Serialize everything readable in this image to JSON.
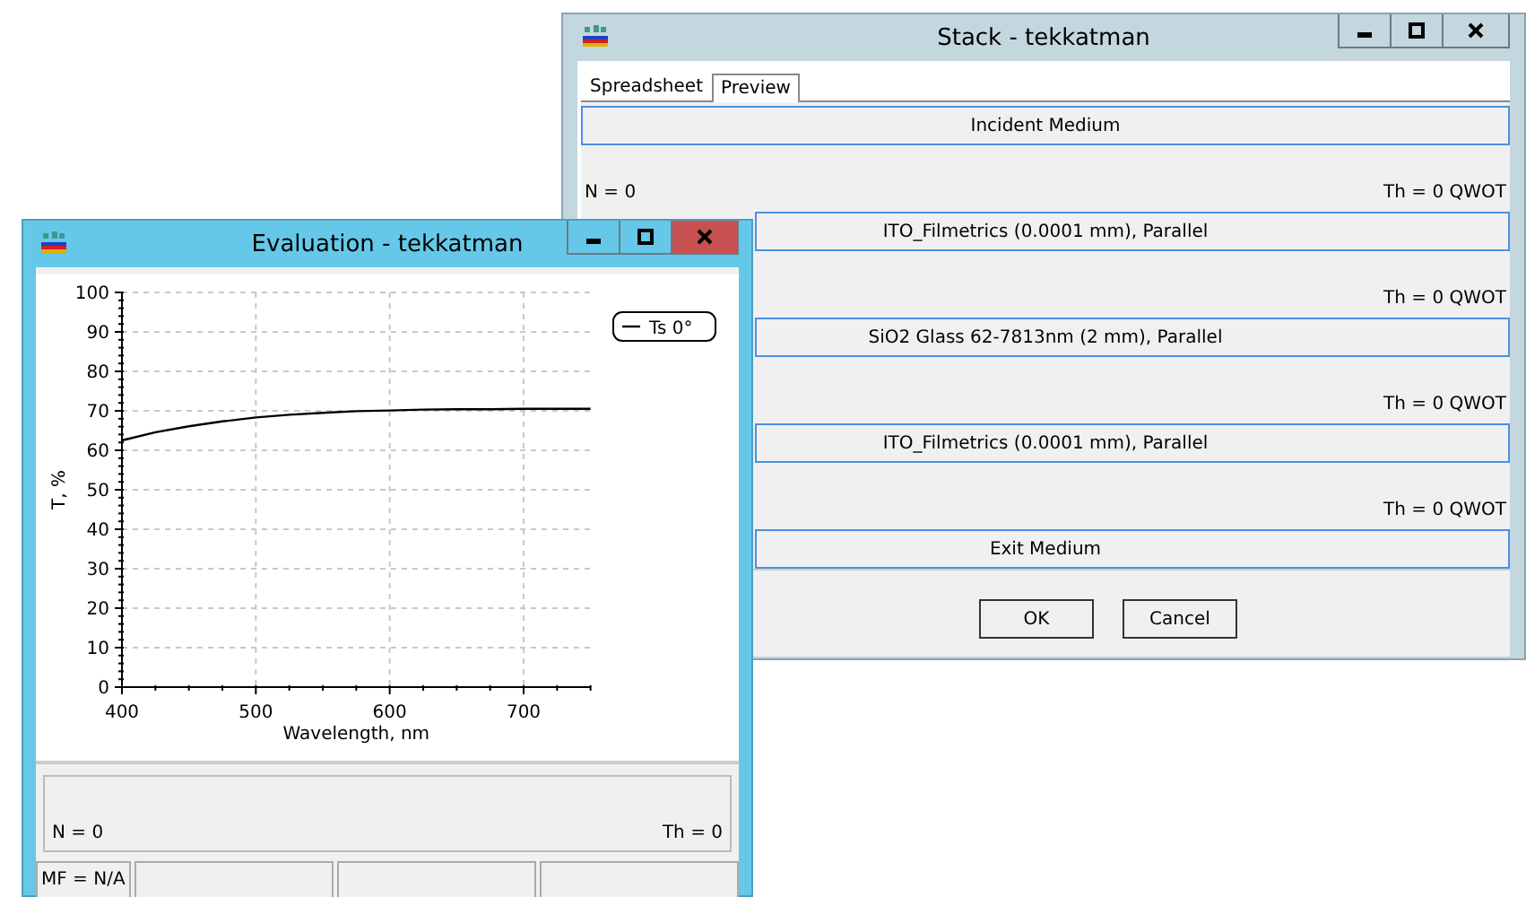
{
  "stack_window": {
    "title": "Stack - tekkatman",
    "tabs": [
      {
        "label": "Spreadsheet",
        "selected": false
      },
      {
        "label": "Preview",
        "selected": true
      }
    ],
    "rows": [
      {
        "kind": "bar",
        "label": "Incident Medium"
      },
      {
        "kind": "info",
        "n": "N = 0",
        "th": "Th = 0 QWOT"
      },
      {
        "kind": "bar",
        "label": "ITO_Filmetrics (0.0001 mm), Parallel"
      },
      {
        "kind": "info",
        "th": "Th = 0 QWOT"
      },
      {
        "kind": "bar",
        "label": "SiO2 Glass 62-7813nm (2 mm), Parallel"
      },
      {
        "kind": "info",
        "th": "Th = 0 QWOT"
      },
      {
        "kind": "bar",
        "label": "ITO_Filmetrics (0.0001 mm), Parallel"
      },
      {
        "kind": "info",
        "th": "Th = 0 QWOT"
      },
      {
        "kind": "bar",
        "label": "Exit Medium"
      }
    ],
    "buttons": [
      "OK",
      "Cancel"
    ]
  },
  "evaluation_window": {
    "title": "Evaluation - tekkatman",
    "chart_data": {
      "type": "line",
      "grid": true,
      "xlabel": "Wavelength, nm",
      "ylabel": "T, %",
      "x": [
        400,
        425,
        450,
        475,
        500,
        525,
        550,
        575,
        600,
        625,
        650,
        675,
        700,
        725,
        750
      ],
      "series": [
        {
          "name": "Ts 0°",
          "color": "#000000",
          "values": [
            62.5,
            64.6,
            66.1,
            67.3,
            68.3,
            69.0,
            69.5,
            69.9,
            70.1,
            70.3,
            70.4,
            70.4,
            70.5,
            70.5,
            70.5
          ]
        }
      ],
      "xlim": [
        400,
        750
      ],
      "ylim": [
        0,
        100
      ],
      "xticks": [
        400,
        500,
        600,
        700
      ],
      "yticks": [
        0,
        10,
        20,
        30,
        40,
        50,
        60,
        70,
        80,
        90,
        100
      ]
    },
    "info": {
      "n": "N = 0",
      "th": "Th = 0"
    },
    "status_bar": [
      "MF = N/A"
    ]
  }
}
